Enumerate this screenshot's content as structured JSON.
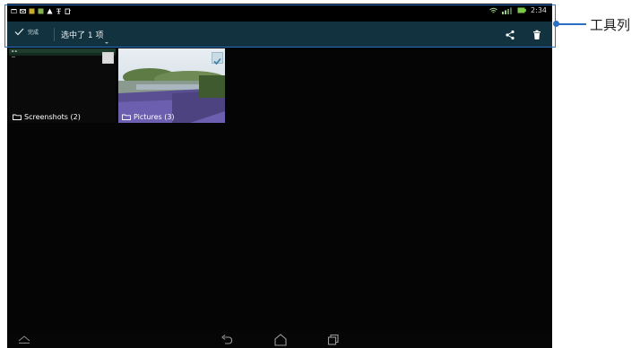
{
  "status_bar": {
    "time": "2:34",
    "left_icons": [
      "window-icon",
      "mail-icon",
      "app-icon",
      "app-icon",
      "warning-icon",
      "usb-icon",
      "clipboard-icon"
    ],
    "right_icons": [
      "wifi-icon",
      "signal-icon",
      "battery-icon"
    ]
  },
  "action_bar": {
    "done_label": "完成",
    "selection_text": "选中了 1 项",
    "share_icon": "share-icon",
    "delete_icon": "trash-icon",
    "background_color": "#12323f"
  },
  "albums": [
    {
      "label": "Screenshots (2)",
      "selected": false
    },
    {
      "label": "Pictures (3)",
      "selected": true
    }
  ],
  "nav_bar": {
    "icons": [
      "up-arrow-icon",
      "back-icon",
      "home-icon",
      "recent-apps-icon"
    ]
  },
  "callout": {
    "label": "工具列",
    "color": "#2a6fc2"
  }
}
